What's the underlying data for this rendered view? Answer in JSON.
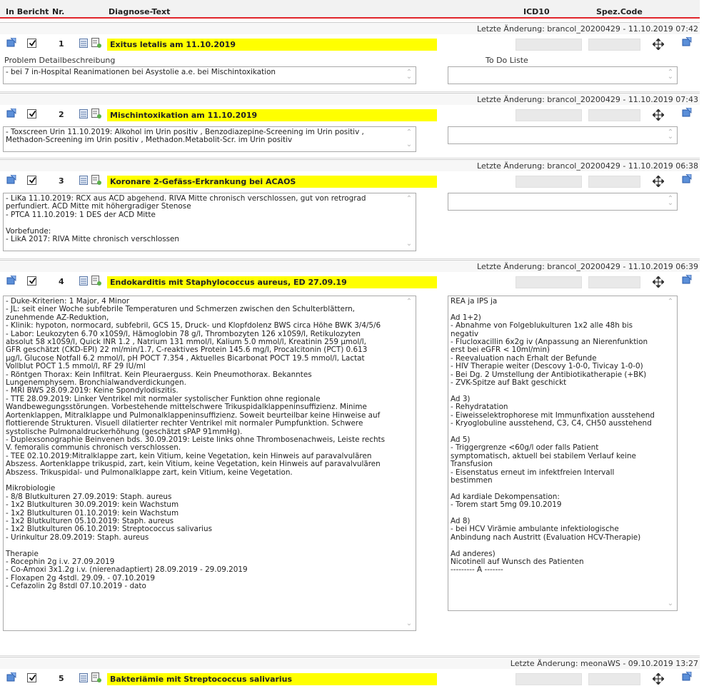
{
  "header": {
    "in_bericht": "In Bericht",
    "nr": "Nr.",
    "diagnose_text": "Diagnose-Text",
    "icd10": "ICD10",
    "spez_code": "Spez.Code"
  },
  "colors": {
    "highlight": "#ffff00",
    "header_border": "#e0252b",
    "code_field": "#e9e9e9"
  },
  "icons": {
    "row_left": "document-arrow-icon",
    "checkbox": "checkbox-checked",
    "list": "list-icon",
    "edit": "edit-doc-icon",
    "move": "move-arrows-icon",
    "row_right": "document-arrow-icon"
  },
  "sub_labels": {
    "problem": "Problem Detailbeschreibung",
    "todo": "To Do Liste"
  },
  "diagnoses": [
    {
      "meta": "Letzte Änderung: brancol_20200429 - 11.10.2019 07:42",
      "nr": "1",
      "title": "Exitus letalis am 11.10.2019",
      "text": "- bei 7 in-Hospital Reanimationen bei Asystolie a.e. bei Mischintoxikation",
      "todo": ""
    },
    {
      "meta": "Letzte Änderung: brancol_20200429 - 11.10.2019 07:43",
      "nr": "2",
      "title": "Mischintoxikation am 11.10.2019",
      "text": "- Toxscreen Urin 11.10.2019: Alkohol im Urin positiv , Benzodiazepine-Screening im Urin positiv ,\nMethadon-Screening im Urin positiv , Methadon.Metabolit-Scr. im Urin positiv",
      "todo": ""
    },
    {
      "meta": "Letzte Änderung: brancol_20200429 - 11.10.2019 06:38",
      "nr": "3",
      "title": "Koronare 2-Gefäss-Erkrankung bei ACAOS",
      "text": "- LiKa 11.10.2019: RCX aus ACD abgehend. RIVA Mitte chronisch verschlossen, gut von retrograd\nperfundiert. ACD Mitte mit höhergradiger Stenose\n- PTCA 11.10.2019: 1 DES der ACD Mitte\n\nVorbefunde:\n- LikA 2017: RIVA Mitte chronisch verschlossen",
      "todo": ""
    },
    {
      "meta": "Letzte Änderung: brancol_20200429 - 11.10.2019 06:39",
      "nr": "4",
      "title": "Endokarditis mit Staphylococcus aureus, ED 27.09.19",
      "text": "- Duke-Kriterien: 1 Major, 4 Minor\n- JL: seit einer Woche subfebrile Temperaturen und Schmerzen zwischen den Schulterblättern,\nzunehmende AZ-Reduktion,\n- Klinik: hypoton, normocard, subfebril, GCS 15, Druck- und Klopfdolenz BWS circa Höhe BWK 3/4/5/6\n- Labor: Leukozyten 6.70 x10S9/l, Hämoglobin 78 g/l, Thrombozyten 126 x10S9/l, Retikulozyten\nabsolut 58 x10S9/l, Quick INR 1.2 , Natrium 131 mmol/l, Kalium 5.0 mmol/l, Kreatinin 259 µmol/l,\nGFR geschätzt (CKD-EPI) 22 ml/min/1.7, C-reaktives Protein 145.6 mg/l, Procalcitonin (PCT) 0.613\nµg/l, Glucose Notfall 6.2 mmol/l, pH POCT 7.354 , Aktuelles Bicarbonat POCT 19.5 mmol/l, Lactat\nVollblut POCT 1.5 mmol/l, RF 29 IU/ml\n- Röntgen Thorax: Kein Infiltrat. Kein Pleuraerguss. Kein Pneumothorax. Bekanntes\nLungenemphysem. Bronchialwandverdickungen.\n- MRI BWS 28.09.2019: Keine Spondylodiszitis.\n- TTE 28.09.2019: Linker Ventrikel mit normaler systolischer Funktion ohne regionale\nWandbewegungsstörungen. Vorbestehende mittelschwere Trikuspidalklappeninsuffizienz. Minime\nAortenklappen, Mitralklappe und Pulmonalklappeninsuffizienz. Soweit beurteilbar keine Hinweise auf\nflottierende Strukturen. Visuell dilatierter rechter Ventrikel mit normaler Pumpfunktion. Schwere\nsystolische Pulmonaldruckerhöhung (geschätzt sPAP 91mmHg).\n- Duplexsonographie Beinvenen bds. 30.09.2019: Leiste links ohne Thrombosenachweis, Leiste rechts\nV. femoralis communis chronisch verschlossen.\n- TEE 02.10.2019:Mitralklappe zart, kein Vitium, keine Vegetation, kein Hinweis auf paravalvulären\nAbszess. Aortenklappe trikuspid, zart, kein Vitium, keine Vegetation, kein Hinweis auf paravalvulären\nAbszess. Trikuspidal- und Pulmonalklappe zart, kein Vitium, keine Vegetation.\n\nMikrobiologie\n- 8/8 Blutkulturen 27.09.2019: Staph. aureus\n- 1x2 Blutkulturen 30.09.2019: kein Wachstum\n- 1x2 Blutkulturen 01.10.2019: kein Wachstum\n- 1x2 Blutkulturen 05.10.2019: Staph. aureus\n- 1x2 Blutkulturen 06.10.2019: Streptococcus salivarius\n- Urinkultur 28.09.2019: Staph. aureus\n\nTherapie\n- Rocephin 2g i.v. 27.09.2019\n- Co-Amoxi 3x1.2g i.v. (nierenadaptiert) 28.09.2019 - 29.09.2019\n- Floxapen 2g 4stdl. 29.09. - 07.10.2019\n- Cefazolin 2g 8stdl 07.10.2019 - dato",
      "todo": "REA ja IPS ja\n\nAd 1+2)\n- Abnahme von Folgeblukulturen 1x2 alle 48h bis\nnegativ\n- Flucloxacillin 6x2g iv (Anpassung an Nierenfunktion\nerst bei eGFR < 10ml/min)\n- Reevaluation nach Erhalt der Befunde\n- HIV Therapie weiter (Descovy 1-0-0, Tivicay 1-0-0)\n- Bei Dg. 2 Umstellung der Antibiotikatherapie (+BK)\n- ZVK-Spitze auf Bakt geschickt\n\nAd 3)\n- Rehydratation\n- Eiweisselektrophorese mit Immunfixation ausstehend\n- Kryoglobuline ausstehend, C3, C4, CH50 ausstehend\n\nAd 5)\n- Triggergrenze <60g/l oder falls Patient\nsymptomatisch, aktuell bei stabilem Verlauf keine\nTransfusion\n- Eisenstatus erneut im infektfreien Intervall\nbestimmen\n\nAd kardiale Dekompensation:\n- Torem start 5mg 09.10.2019\n\nAd 8)\n- bei HCV Virämie ambulante infektiologische\nAnbindung nach Austritt (Evaluation HCV-Therapie)\n\nAd anderes)\nNicotinell auf Wunsch des Patienten\n--------- A -------"
    },
    {
      "meta": "Letzte Änderung: meonaWS - 09.10.2019 13:27",
      "nr": "5",
      "title": "Bakteriämie mit Streptococcus salivarius",
      "text": "",
      "todo": ""
    }
  ]
}
